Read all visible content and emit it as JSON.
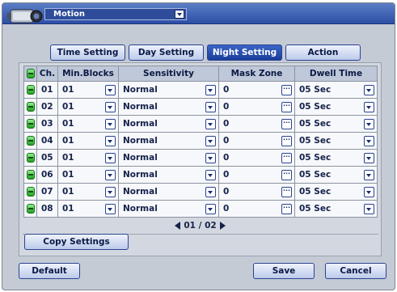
{
  "header": {
    "title": "Motion"
  },
  "tabs": [
    {
      "label": "Time Setting"
    },
    {
      "label": "Day Setting"
    },
    {
      "label": "Night Setting"
    },
    {
      "label": "Action"
    }
  ],
  "columns": [
    "Ch.",
    "Min.Blocks",
    "Sensitivity",
    "Mask Zone",
    "Dwell Time"
  ],
  "rows": [
    {
      "ch": "01",
      "min_blocks": "01",
      "sensitivity": "Normal",
      "mask_zone": "0",
      "dwell_time": "05 Sec"
    },
    {
      "ch": "02",
      "min_blocks": "01",
      "sensitivity": "Normal",
      "mask_zone": "0",
      "dwell_time": "05 Sec"
    },
    {
      "ch": "03",
      "min_blocks": "01",
      "sensitivity": "Normal",
      "mask_zone": "0",
      "dwell_time": "05 Sec"
    },
    {
      "ch": "04",
      "min_blocks": "01",
      "sensitivity": "Normal",
      "mask_zone": "0",
      "dwell_time": "05 Sec"
    },
    {
      "ch": "05",
      "min_blocks": "01",
      "sensitivity": "Normal",
      "mask_zone": "0",
      "dwell_time": "05 Sec"
    },
    {
      "ch": "06",
      "min_blocks": "01",
      "sensitivity": "Normal",
      "mask_zone": "0",
      "dwell_time": "05 Sec"
    },
    {
      "ch": "07",
      "min_blocks": "01",
      "sensitivity": "Normal",
      "mask_zone": "0",
      "dwell_time": "05 Sec"
    },
    {
      "ch": "08",
      "min_blocks": "01",
      "sensitivity": "Normal",
      "mask_zone": "0",
      "dwell_time": "05 Sec"
    }
  ],
  "pager": {
    "text": "01 / 02"
  },
  "buttons": {
    "copy_settings": "Copy Settings",
    "default": "Default",
    "save": "Save",
    "cancel": "Cancel"
  },
  "colors": {
    "title_bar": "#2c4fa6",
    "active_tab": "#1a3d99",
    "panel_bg": "#c5cbd5",
    "check_green": "#1ea01e"
  },
  "icons": {
    "window": "camera-icon",
    "row_toggle": "check-icon",
    "dropdown": "chevron-down-icon",
    "mask_zone_editor": "more-icon",
    "pager_prev": "prev-icon",
    "pager_next": "next-icon"
  }
}
